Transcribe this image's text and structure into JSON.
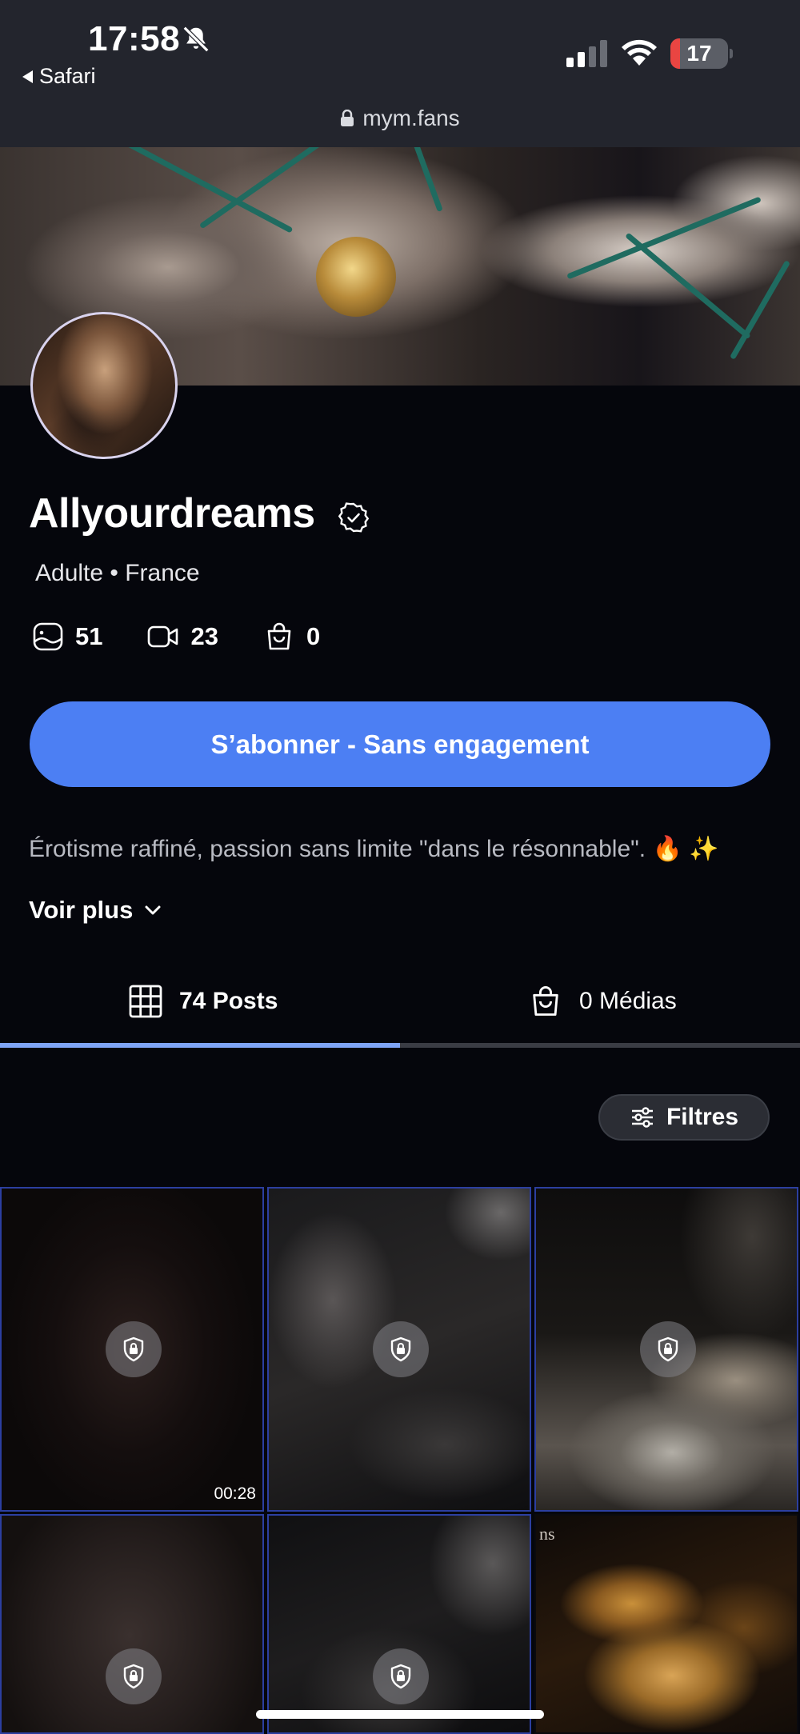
{
  "status_bar": {
    "time": "17:58",
    "back_app": "Safari",
    "battery_level": "17",
    "icons": [
      "bell-slash-icon",
      "cellular-signal-icon",
      "wifi-icon",
      "battery-icon"
    ]
  },
  "browser": {
    "url": "mym.fans",
    "lock_icon": "lock-icon"
  },
  "profile": {
    "name": "Allyourdreams",
    "verified_icon": "verified-badge-icon",
    "meta": "Adulte • France",
    "stats": [
      {
        "icon": "photo-icon",
        "value": "51"
      },
      {
        "icon": "video-icon",
        "value": "23"
      },
      {
        "icon": "shopping-bag-icon",
        "value": "0"
      }
    ],
    "subscribe_label": "S’abonner - Sans engagement",
    "bio": "Érotisme raffiné, passion sans limite \"dans le résonnable\". 🔥 ✨",
    "see_more_label": "Voir plus"
  },
  "tabs": [
    {
      "label": "74 Posts",
      "icon": "grid-icon",
      "active": true
    },
    {
      "label": "0 Médias",
      "icon": "shopping-bag-icon",
      "active": false
    }
  ],
  "filters": {
    "label": "Filtres",
    "icon": "sliders-icon"
  },
  "posts": [
    {
      "locked": true,
      "duration": "00:28"
    },
    {
      "locked": true,
      "duration": ""
    },
    {
      "locked": true,
      "duration": ""
    },
    {
      "locked": true,
      "duration": ""
    },
    {
      "locked": true,
      "duration": ""
    },
    {
      "locked": false,
      "duration": "",
      "corner_text": "ns"
    }
  ],
  "colors": {
    "background": "#05060c",
    "accent": "#4c7ff3",
    "tab_indicator": "#7ea4f5",
    "topbar": "#23252d",
    "battery_low": "#e94542"
  }
}
